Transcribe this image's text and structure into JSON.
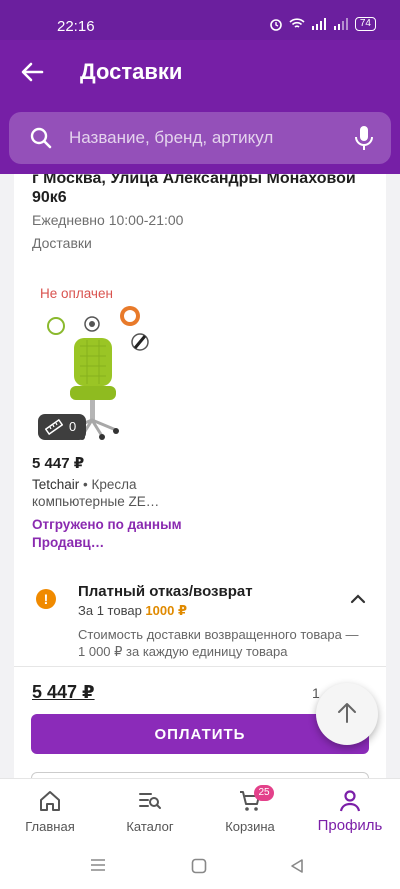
{
  "status_bar": {
    "time": "22:16",
    "battery": "74"
  },
  "app_bar": {
    "title": "Доставки"
  },
  "search": {
    "placeholder": "Название, бренд, артикул"
  },
  "delivery": {
    "address": "г Москва, Улица Александры Монаховой 90к6",
    "hours": "Ежедневно 10:00-21:00",
    "type": "Доставки"
  },
  "product": {
    "status": "Не оплачен",
    "measure_count": "0",
    "price": "5 447 ₽",
    "brand": "Tetchair",
    "separator": " • ",
    "category": "Кресла компьютерные ZE…",
    "shipped": "Отгружено по данным Продавц…"
  },
  "refund": {
    "title": "Платный отказ/возврат",
    "subtitle": "За 1 товар",
    "price": "1000 ₽",
    "description": "Стоимость доставки возвращенного товара — 1 000 ₽ за каждую единицу товара"
  },
  "summary": {
    "total": "5 447 ₽",
    "count": "1"
  },
  "pay_button": {
    "label": "ОПЛАТИТЬ"
  },
  "bottom_nav": {
    "items": [
      {
        "label": "Главная"
      },
      {
        "label": "Каталог"
      },
      {
        "label": "Корзина",
        "badge": "25"
      },
      {
        "label": "Профиль"
      }
    ]
  },
  "colors": {
    "brand": "#761fa6",
    "accent": "#8b2bb9",
    "warning": "#f08a00",
    "badge": "#e3418a"
  }
}
